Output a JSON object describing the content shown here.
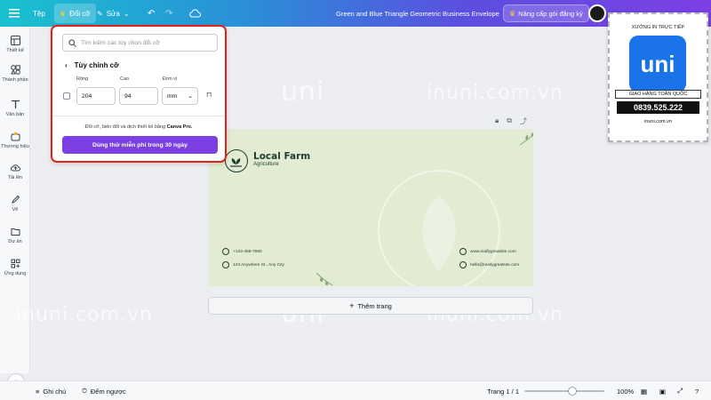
{
  "topbar": {
    "file_label": "Tệp",
    "resize_label": "Đổi cỡ",
    "edit_label": "Sửa",
    "doc_title": "Green and Blue Triangle Geometric Business Envelope",
    "upgrade_label": "Nâng cấp gói đăng ký"
  },
  "sidebar": {
    "items": [
      {
        "label": "Thiết kế",
        "icon": "layout-icon"
      },
      {
        "label": "Thành phần",
        "icon": "shapes-icon"
      },
      {
        "label": "Văn bản",
        "icon": "text-icon"
      },
      {
        "label": "Thương hiệu",
        "icon": "brand-icon"
      },
      {
        "label": "Tải lên",
        "icon": "upload-icon"
      },
      {
        "label": "Vẽ",
        "icon": "draw-icon"
      },
      {
        "label": "Dự án",
        "icon": "folder-icon"
      },
      {
        "label": "Ứng dụng",
        "icon": "apps-icon"
      }
    ]
  },
  "popup": {
    "search_placeholder": "Tìm kiếm các tùy chọn đổi cỡ",
    "section_title": "Tùy chỉnh cỡ",
    "width_label": "Rộng",
    "height_label": "Cao",
    "unit_label": "Đơn vị",
    "width_value": "204",
    "height_value": "94",
    "unit_value": "mm",
    "note_prefix": "Đổi cỡ, biến đổi và dịch thiết kế bằng",
    "note_brand": "Canva Pro.",
    "cta_label": "Dùng thử miễn phí trong 30 ngày"
  },
  "design": {
    "brand_name": "Local Farm",
    "brand_sub": "Agriculture",
    "phone": "+123-456-7890",
    "address": "123 Anywhere St., Any City",
    "website": "www.reallygreatsite.com",
    "email": "hello@reallygreatsite.com"
  },
  "add_page_label": "Thêm trang",
  "bottombar": {
    "notes_label": "Ghi chú",
    "timer_label": "Đếm ngược",
    "page_indicator": "Trang 1 / 1",
    "zoom": "100%",
    "zoom_fraction": 0.6
  },
  "watermark": {
    "brand": "uni",
    "site": "inuni.com.vn"
  },
  "sticker": {
    "top_text": "XƯỞNG IN TRỰC TIẾP",
    "logo_text": "uni",
    "ship_text": "GIAO HÀNG TOÀN QUỐC",
    "phone": "0839.525.222",
    "url": "inuni.com.vn"
  },
  "colors": {
    "accent": "#7b3fe4",
    "highlight_border": "#e3211c",
    "design_bg": "#e1ecd3",
    "brand_green": "#1f3d2e"
  }
}
